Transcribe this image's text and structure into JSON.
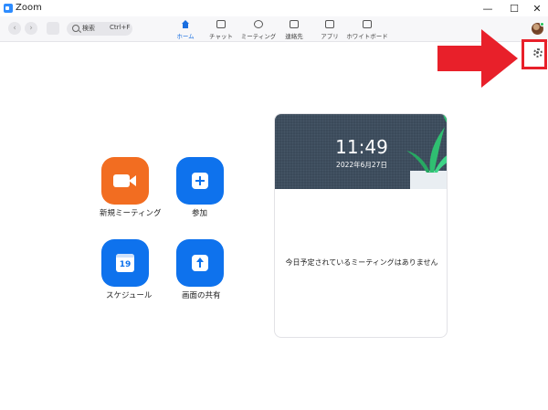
{
  "window": {
    "title": "Zoom",
    "minimize": "—",
    "maximize": "☐",
    "close": "✕"
  },
  "toolbar": {
    "back": "‹",
    "forward": "›",
    "search_label": "検索",
    "search_shortcut": "Ctrl+F",
    "tabs": [
      {
        "label": "ホーム",
        "icon": "home-icon",
        "active": true
      },
      {
        "label": "チャット",
        "icon": "chat-icon"
      },
      {
        "label": "ミーティング",
        "icon": "clock-icon"
      },
      {
        "label": "連絡先",
        "icon": "contacts-icon"
      },
      {
        "label": "アプリ",
        "icon": "apps-icon"
      },
      {
        "label": "ホワイトボード",
        "icon": "whiteboard-icon"
      }
    ]
  },
  "actions": {
    "new_meeting": "新規ミーティング",
    "new_meeting_caret": "⌄",
    "join": "参加",
    "schedule": "スケジュール",
    "schedule_day": "19",
    "share_screen": "画面の共有"
  },
  "colors": {
    "accent": "#0e72ed",
    "new_meeting": "#f26d21",
    "highlight": "#e8202a"
  },
  "calendar_card": {
    "time": "11:49",
    "date": "2022年6月27日",
    "empty_message": "今日予定されているミーティングはありません"
  }
}
